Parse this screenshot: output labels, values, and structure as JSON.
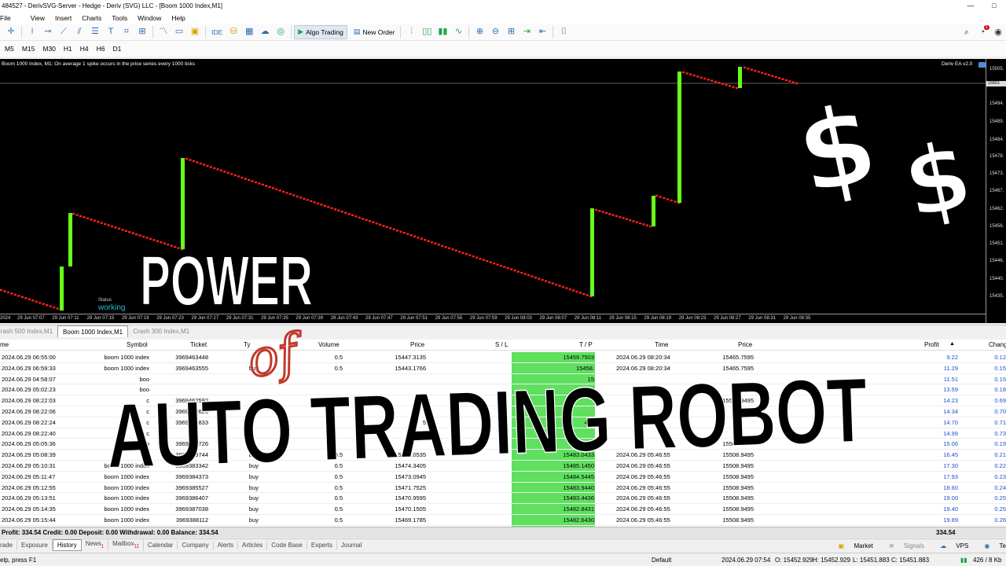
{
  "window": {
    "title": "484527 - DerivSVG-Server - Hedge - Deriv (SVG) LLC - [Boom 1000 Index,M1]",
    "minimize": "—",
    "maximize": "□"
  },
  "menu": [
    "File",
    "View",
    "Insert",
    "Charts",
    "Tools",
    "Window",
    "Help"
  ],
  "toolbar": {
    "ide": "IDE",
    "algo_trading": "Algo Trading",
    "new_order": "New Order",
    "notif_count": "1"
  },
  "timeframes": [
    "M5",
    "M15",
    "M30",
    "H1",
    "H4",
    "H6",
    "D1"
  ],
  "chart": {
    "info": "Boom 1000 Index, M1:  On average 1 spike occurs in the price series every 1000 ticks",
    "ea_label": "Deriv EA v2.0",
    "status_label": "Status",
    "status_value": "working",
    "current_price": "15501",
    "price_labels": [
      "15505.",
      "15501",
      "15494.",
      "15489.",
      "15484.",
      "15478.",
      "15473.",
      "15467.",
      "15462.",
      "15456.",
      "15451.",
      "15446.",
      "15440.",
      "15435."
    ],
    "time_labels": [
      "2024",
      "29 Jun 07:07",
      "29 Jun 07:11",
      "29 Jun 07:15",
      "29 Jun 07:19",
      "29 Jun 07:23",
      "29 Jun 07:27",
      "29 Jun 07:31",
      "29 Jun 07:35",
      "29 Jun 07:39",
      "29 Jun 07:43",
      "29 Jun 07:47",
      "29 Jun 07:51",
      "29 Jun 07:55",
      "29 Jun 07:59",
      "29 Jun 08:03",
      "29 Jun 08:07",
      "29 Jun 08:11",
      "29 Jun 08:15",
      "29 Jun 08:19",
      "29 Jun 08:23",
      "29 Jun 08:27",
      "29 Jun 08:31",
      "29 Jun 08:35"
    ]
  },
  "chart_tabs": [
    "Crash 500 Index,M1",
    "Boom 1000 Index,M1",
    "Crash 300 Index,M1"
  ],
  "table": {
    "headers": {
      "time": "me",
      "symbol": "Symbol",
      "ticket": "Ticket",
      "type": "Ty",
      "volume": "Volume",
      "price": "Price",
      "sl": "S / L",
      "tp": "T / P",
      "time2": "Time",
      "price2": "Price",
      "profit": "Profit",
      "change": "Chang"
    },
    "rows": [
      {
        "time": "2024.06.29 06:55:00",
        "symbol": "boom 1000 index",
        "ticket": "3969463448",
        "type": "",
        "volume": "0.5",
        "price": "15447.3135",
        "tp": "15459.7503",
        "time2": "2024.06.29 08:20:34",
        "price2": "15465.7595",
        "profit": "9.22",
        "change": "0.12"
      },
      {
        "time": "2024.06.29 06:59:33",
        "symbol": "boom 1000 index",
        "ticket": "3969463555",
        "type": "buy",
        "volume": "0.5",
        "price": "15443.1766",
        "tp": "15458.",
        "time2": "2024.06.29 08:20:34",
        "price2": "15465.7595",
        "profit": "11.29",
        "change": "0.15"
      },
      {
        "time": "2024.06.29 04:58:07",
        "symbol": "boo",
        "ticket": "",
        "type": "",
        "volume": "",
        "price": "",
        "tp": "15",
        "time2": "",
        "price2": "",
        "profit": "11.51",
        "change": "0.15"
      },
      {
        "time": "2024.06.29 05:02:23",
        "symbol": "boo",
        "ticket": "",
        "type": "",
        "volume": "",
        "price": "",
        "tp": "15465",
        "time2": "",
        "price2": "",
        "profit": "13.59",
        "change": "0.18"
      },
      {
        "time": "2024.06.29 08:22:03",
        "symbol": "c",
        "ticket": "3969462592",
        "type": "",
        "volume": "",
        "price": "",
        "tp": "",
        "time2": "",
        "price2": "15508.9495",
        "profit": "14.23",
        "change": "0.69"
      },
      {
        "time": "2024.06.29 08:22:06",
        "symbol": "c",
        "ticket": "3969462626",
        "type": "",
        "volume": "",
        "price": "",
        "tp": "",
        "time2": "",
        "price2": "",
        "profit": "14.34",
        "change": "0.70"
      },
      {
        "time": "2024.06.29 08:22:24",
        "symbol": "c",
        "ticket": "3969463833",
        "type": "",
        "volume": "",
        "price": "5",
        "tp": "495",
        "time2": "",
        "price2": "",
        "profit": "14.70",
        "change": "0.71"
      },
      {
        "time": "2024.06.29 08:22:40",
        "symbol": "c",
        "ticket": "",
        "type": "",
        "volume": "",
        "price": "",
        "tp": "",
        "time2": "",
        "price2": "",
        "profit": "14.99",
        "change": "0.73"
      },
      {
        "time": "2024.06.29 05:05:36",
        "symbol": "bo",
        "ticket": "3969383726",
        "type": "",
        "volume": "",
        "price": "",
        "tp": "15483",
        "time2": "",
        "price2": "15508.9495",
        "profit": "15.06",
        "change": "0.19"
      },
      {
        "time": "2024.06.29 05:08:39",
        "symbol": "bo",
        "ticket": "3969373744",
        "type": "buy",
        "volume": "0.5",
        "price": "15476.0535",
        "tp": "15483.0433",
        "time2": "2024.06.29 05:46:55",
        "price2": "15508.9495",
        "profit": "16.45",
        "change": "0.21"
      },
      {
        "time": "2024.06.29 05:10:31",
        "symbol": "boom 1000 index",
        "ticket": "3969383342",
        "type": "buy",
        "volume": "0.5",
        "price": "15474.3405",
        "tp": "15485.1450",
        "time2": "2024.06.29 05:46:55",
        "price2": "15508.9495",
        "profit": "17.30",
        "change": "0.22"
      },
      {
        "time": "2024.06.29 05:11:47",
        "symbol": "boom 1000 index",
        "ticket": "3969384373",
        "type": "buy",
        "volume": "0.5",
        "price": "15473.0945",
        "tp": "15484.5445",
        "time2": "2024.06.29 05:46:55",
        "price2": "15508.9495",
        "profit": "17.93",
        "change": "0.23"
      },
      {
        "time": "2024.06.29 05:12:55",
        "symbol": "boom 1000 index",
        "ticket": "3969385527",
        "type": "buy",
        "volume": "0.5",
        "price": "15471.7525",
        "tp": "15483.9440",
        "time2": "2024.06.29 05:46:55",
        "price2": "15508.9495",
        "profit": "18.60",
        "change": "0.24"
      },
      {
        "time": "2024.06.29 05:13:51",
        "symbol": "boom 1000 index",
        "ticket": "3969386407",
        "type": "buy",
        "volume": "0.5",
        "price": "15470.9595",
        "tp": "15483.4436",
        "time2": "2024.06.29 05:46:55",
        "price2": "15508.9495",
        "profit": "19.00",
        "change": "0.25"
      },
      {
        "time": "2024.06.29 05:14:35",
        "symbol": "boom 1000 index",
        "ticket": "3969387038",
        "type": "buy",
        "volume": "0.5",
        "price": "15470.1505",
        "tp": "15482.8431",
        "time2": "2024.06.29 05:46:55",
        "price2": "15508.9495",
        "profit": "19.40",
        "change": "0.25"
      },
      {
        "time": "2024.06.29 05:15:44",
        "symbol": "boom 1000 index",
        "ticket": "3969388112",
        "type": "buy",
        "volume": "0.5",
        "price": "15469.1785",
        "tp": "15482.6430",
        "time2": "2024.06.29 05:46:55",
        "price2": "15508.9495",
        "profit": "19.89",
        "change": "0.26"
      }
    ]
  },
  "summary": {
    "text": "Profit: 334.54  Credit: 0.00  Deposit: 0.00  Withdrawal: 0.00  Balance: 334.54",
    "total": "334.54"
  },
  "bottom_tabs": {
    "items": [
      "rade",
      "Exposure",
      "History",
      "News",
      "Mailbox",
      "Calendar",
      "Company",
      "Alerts",
      "Articles",
      "Code Base",
      "Experts",
      "Journal"
    ],
    "news_badge": "1",
    "mailbox_badge": "11",
    "market": "Market",
    "signals": "Signals",
    "vps": "VPS",
    "te": "Te"
  },
  "statusbar": {
    "help": "elp, press F1",
    "profile": "Default",
    "datetime": "2024.06.29 07:54",
    "open": "O: 15452.929",
    "high": "H: 15452.929",
    "low": "L: 15451.883",
    "close": "C: 15451.883",
    "traffic": "426 / 8 Kb"
  },
  "overlay": {
    "word1": "POWER",
    "word2": "of",
    "word3": "AUTO TRADING ROBOT",
    "dollar": "$"
  },
  "colors": {
    "bull": "#66ff1a",
    "bear": "#ff2020",
    "tp_highlight": "#5fe05f",
    "status": "#2fb9d6"
  }
}
